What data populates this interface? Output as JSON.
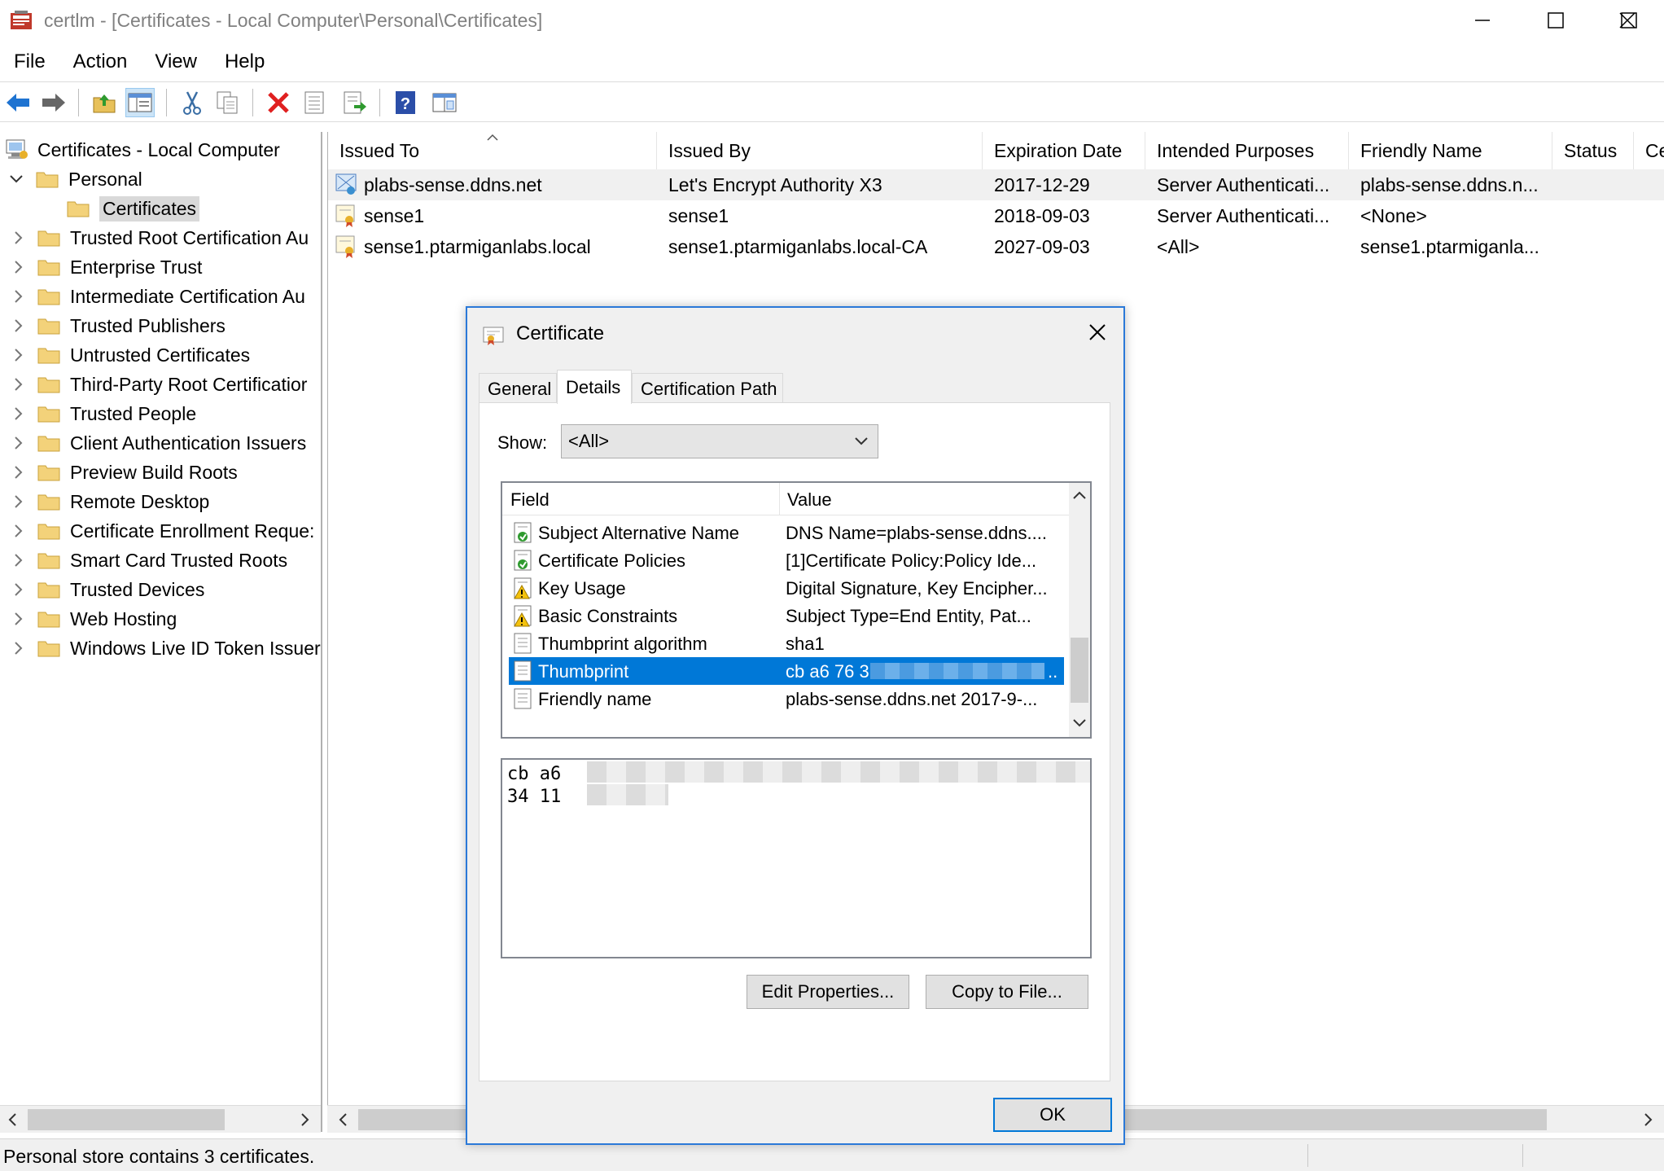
{
  "window": {
    "title": "certlm - [Certificates - Local Computer\\Personal\\Certificates]"
  },
  "menu": [
    "File",
    "Action",
    "View",
    "Help"
  ],
  "toolbar": {
    "buttons": [
      "back-arrow-icon",
      "forward-arrow-icon",
      "up-folder-icon",
      "show-hide-tree-icon",
      "cut-icon",
      "copy-icon",
      "delete-icon",
      "properties-icon",
      "export-list-icon",
      "help-icon",
      "console-icon"
    ]
  },
  "tree": {
    "root": "Certificates - Local Computer",
    "personal": "Personal",
    "certificates": "Certificates",
    "items": [
      "Trusted Root Certification Au",
      "Enterprise Trust",
      "Intermediate Certification Au",
      "Trusted Publishers",
      "Untrusted Certificates",
      "Third-Party Root Certificatior",
      "Trusted People",
      "Client Authentication Issuers",
      "Preview Build Roots",
      "Remote Desktop",
      "Certificate Enrollment Reque:",
      "Smart Card Trusted Roots",
      "Trusted Devices",
      "Web Hosting",
      "Windows Live ID Token Issuer"
    ]
  },
  "list": {
    "columns": [
      "Issued To",
      "Issued By",
      "Expiration Date",
      "Intended Purposes",
      "Friendly Name",
      "Status",
      "Ce"
    ],
    "rows": [
      {
        "issued_to": "plabs-sense.ddns.net",
        "issued_by": "Let's Encrypt Authority X3",
        "expiration": "2017-12-29",
        "purposes": "Server Authenticati...",
        "friendly": "plabs-sense.ddns.n..."
      },
      {
        "issued_to": "sense1",
        "issued_by": "sense1",
        "expiration": "2018-09-03",
        "purposes": "Server Authenticati...",
        "friendly": "<None>"
      },
      {
        "issued_to": "sense1.ptarmiganlabs.local",
        "issued_by": "sense1.ptarmiganlabs.local-CA",
        "expiration": "2027-09-03",
        "purposes": "<All>",
        "friendly": "sense1.ptarmiganla..."
      }
    ]
  },
  "status": "Personal store contains 3 certificates.",
  "dialog": {
    "title": "Certificate",
    "tabs": [
      "General",
      "Details",
      "Certification Path"
    ],
    "active_tab": "Details",
    "show_label": "Show:",
    "show_value": "<All>",
    "field_header": "Field",
    "value_header": "Value",
    "fields": [
      {
        "field": "Subject Alternative Name",
        "value": "DNS Name=plabs-sense.ddns....",
        "icon": "extension-icon"
      },
      {
        "field": "Certificate Policies",
        "value": "[1]Certificate Policy:Policy Ide...",
        "icon": "extension-icon"
      },
      {
        "field": "Key Usage",
        "value": "Digital Signature, Key Encipher...",
        "icon": "critical-extension-icon"
      },
      {
        "field": "Basic Constraints",
        "value": "Subject Type=End Entity, Pat...",
        "icon": "critical-extension-icon"
      },
      {
        "field": "Thumbprint algorithm",
        "value": "sha1",
        "icon": "property-icon"
      },
      {
        "field": "Thumbprint",
        "value": "cb a6 76 3",
        "icon": "property-icon",
        "selected": true
      },
      {
        "field": "Friendly name",
        "value": "plabs-sense.ddns.net 2017-9-...",
        "icon": "property-icon"
      }
    ],
    "value_box_lines": [
      "cb a6",
      "34 11"
    ],
    "edit_properties": "Edit Properties...",
    "copy_to_file": "Copy to File...",
    "ok": "OK"
  }
}
